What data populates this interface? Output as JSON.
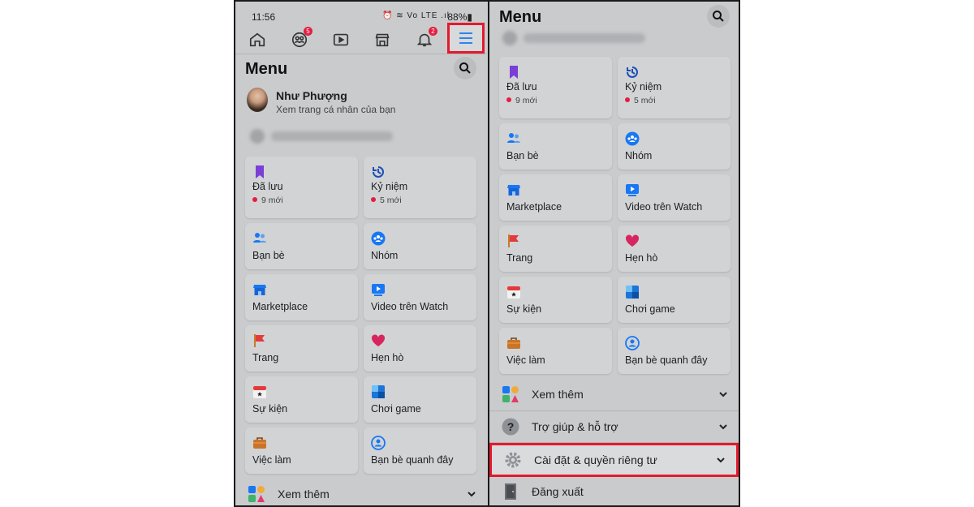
{
  "status_bar": {
    "time": "11:56",
    "battery": "88%",
    "indicators": "⏰ ≋ Vo LTE .ıl"
  },
  "nav": {
    "items": [
      {
        "name": "home-icon",
        "badge": ""
      },
      {
        "name": "friends-icon",
        "badge": "5"
      },
      {
        "name": "watch-icon",
        "badge": ""
      },
      {
        "name": "marketplace-icon",
        "badge": ""
      },
      {
        "name": "notifications-icon",
        "badge": "2"
      },
      {
        "name": "hamburger-menu-icon",
        "badge": ""
      }
    ]
  },
  "left": {
    "title": "Menu",
    "profile": {
      "name": "Như Phượng",
      "subtitle": "Xem trang cá nhân của bạn"
    },
    "cards": [
      {
        "label": "Đã lưu",
        "sub": "9 mới",
        "icon": "bookmark-icon"
      },
      {
        "label": "Kỷ niệm",
        "sub": "5 mới",
        "icon": "memories-clock-icon"
      },
      {
        "label": "Bạn bè",
        "icon": "friends-people-icon"
      },
      {
        "label": "Nhóm",
        "icon": "groups-icon"
      },
      {
        "label": "Marketplace",
        "icon": "marketplace-store-icon"
      },
      {
        "label": "Video trên Watch",
        "icon": "watch-video-icon"
      },
      {
        "label": "Trang",
        "icon": "pages-flag-icon"
      },
      {
        "label": "Hẹn hò",
        "icon": "dating-heart-icon"
      },
      {
        "label": "Sự kiện",
        "icon": "events-calendar-icon"
      },
      {
        "label": "Chơi game",
        "icon": "gaming-icon"
      },
      {
        "label": "Việc làm",
        "icon": "jobs-briefcase-icon"
      },
      {
        "label": "Bạn bè quanh đây",
        "icon": "nearby-friends-icon"
      }
    ],
    "see_more": "Xem thêm"
  },
  "right": {
    "title": "Menu",
    "cards": [
      {
        "label": "Đã lưu",
        "sub": "9 mới"
      },
      {
        "label": "Kỷ niệm",
        "sub": "5 mới"
      },
      {
        "label": "Bạn bè"
      },
      {
        "label": "Nhóm"
      },
      {
        "label": "Marketplace"
      },
      {
        "label": "Video trên Watch"
      },
      {
        "label": "Trang"
      },
      {
        "label": "Hẹn hò"
      },
      {
        "label": "Sự kiện"
      },
      {
        "label": "Chơi game"
      },
      {
        "label": "Việc làm"
      },
      {
        "label": "Bạn bè quanh đây"
      }
    ],
    "rows": [
      {
        "label": "Xem thêm",
        "icon": "see-more-apps-icon"
      },
      {
        "label": "Trợ giúp & hỗ trợ",
        "icon": "help-question-icon"
      },
      {
        "label": "Cài đặt & quyền riêng tư",
        "icon": "settings-gear-icon"
      },
      {
        "label": "Đăng xuất",
        "icon": "logout-door-icon"
      }
    ]
  },
  "colors": {
    "highlight_border": "#e5192d",
    "badge": "#e41e3f",
    "fb_blue": "#1877f2",
    "overlay_bg": "#c9cbcd"
  }
}
